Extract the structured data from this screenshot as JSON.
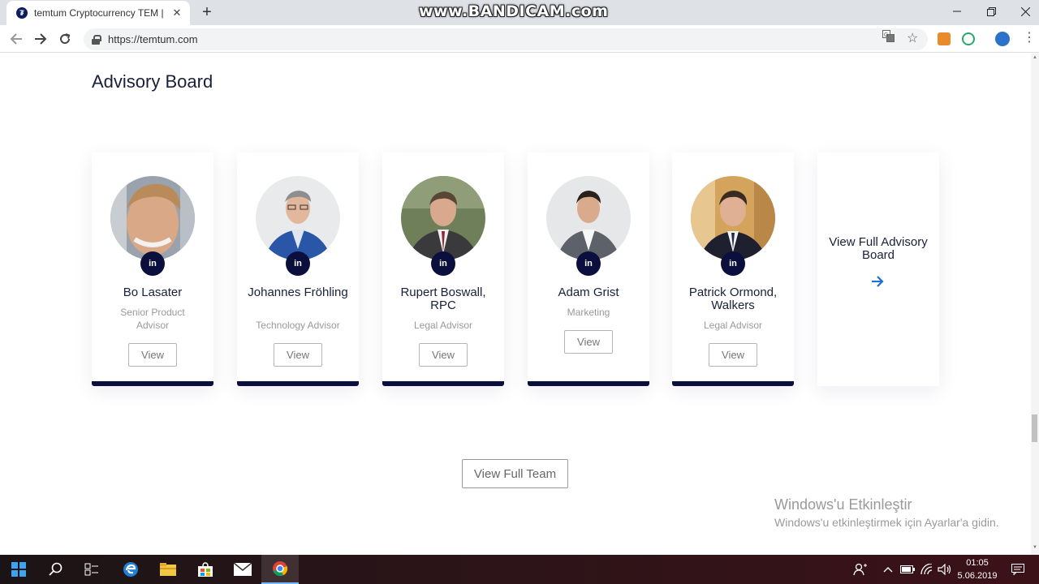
{
  "browser": {
    "tab_title": "temtum Cryptocurrency TEM | Qu",
    "tab_close": "✕",
    "new_tab": "+",
    "url": "https://temtum.com",
    "watermark": "www.BANDICAM.com"
  },
  "page": {
    "section_title": "Advisory Board",
    "linkedin_label": "in",
    "view_label": "View",
    "members": [
      {
        "name": "Bo Lasater",
        "role": "Senior Product Advisor"
      },
      {
        "name": "Johannes Fröhling",
        "role": "Technology Advisor"
      },
      {
        "name": "Rupert Boswall, RPC",
        "role": "Legal Advisor"
      },
      {
        "name": "Adam Grist",
        "role": "Marketing"
      },
      {
        "name": "Patrick Ormond, Walkers",
        "role": "Legal Advisor"
      }
    ],
    "view_full_board": "View Full Advisory Board",
    "view_full_team": "View Full Team",
    "accent_color": "#0b0f3d",
    "link_color": "#1f6fd6"
  },
  "os": {
    "activation_title": "Windows'u Etkinleştir",
    "activation_subtitle": "Windows'u etkinleştirmek için Ayarlar'a gidin.",
    "time": "01:05",
    "date": "5.06.2019"
  }
}
